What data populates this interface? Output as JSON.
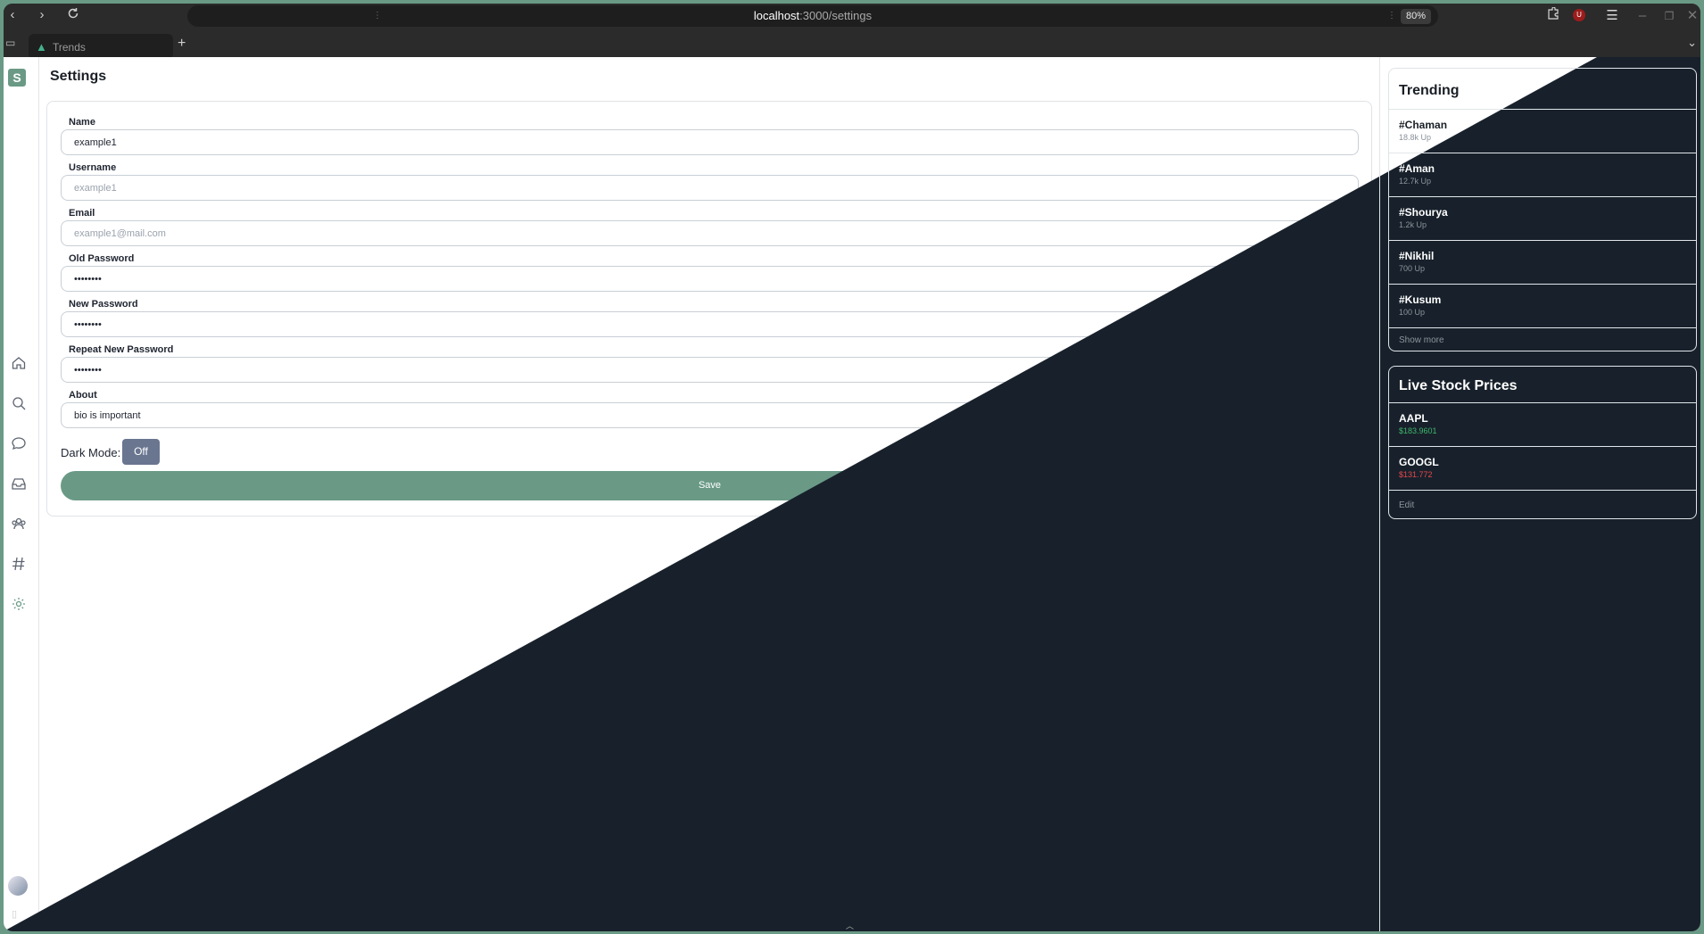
{
  "browser": {
    "url_host": "localhost",
    "url_path": ":3000/settings",
    "zoom": "80%",
    "tab_title": "Trends",
    "new_tab": "+",
    "ublock_count": "U"
  },
  "sidebar": {
    "logo_letter": "S",
    "icons": [
      "home-icon",
      "search-icon",
      "chat-icon",
      "inbox-icon",
      "community-icon",
      "hashtag-icon",
      "settings-icon"
    ]
  },
  "settings": {
    "title": "Settings",
    "fields": [
      {
        "label": "Name",
        "value": "example1",
        "placeholder": ""
      },
      {
        "label": "Username",
        "value": "",
        "placeholder": "example1"
      },
      {
        "label": "Email",
        "value": "",
        "placeholder": "example1@mail.com"
      },
      {
        "label": "Old Password",
        "value": "••••••••",
        "placeholder": ""
      },
      {
        "label": "New Password",
        "value": "••••••••",
        "placeholder": ""
      },
      {
        "label": "Repeat New Password",
        "value": "••••••••",
        "placeholder": ""
      },
      {
        "label": "About",
        "value": "bio is important",
        "placeholder": ""
      }
    ],
    "dark_mode_label": "Dark Mode:",
    "dark_mode_value": "Off",
    "save_label": "Save"
  },
  "trending": {
    "title": "Trending",
    "items": [
      {
        "tag": "#Chaman",
        "count": "18.8k Up"
      },
      {
        "tag": "#Aman",
        "count": "12.7k Up"
      },
      {
        "tag": "#Shourya",
        "count": "1.2k Up"
      },
      {
        "tag": "#Nikhil",
        "count": "700 Up"
      },
      {
        "tag": "#Kusum",
        "count": "100 Up"
      }
    ],
    "show_more": "Show more"
  },
  "stocks": {
    "title": "Live Stock Prices",
    "items": [
      {
        "symbol": "AAPL",
        "price": "$183.9601",
        "trend": "up"
      },
      {
        "symbol": "GOOGL",
        "price": "$131.772",
        "trend": "down"
      }
    ],
    "edit_label": "Edit"
  },
  "colors": {
    "accent": "#6a9a86",
    "dark_bg": "#18212b",
    "price_up": "#3fb66b",
    "price_down": "#e5484d"
  }
}
